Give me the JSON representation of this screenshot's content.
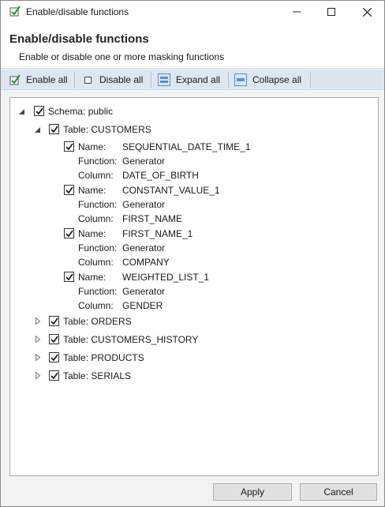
{
  "window": {
    "title": "Enable/disable functions"
  },
  "header": {
    "title": "Enable/disable functions",
    "subtitle": "Enable or disable one or more masking functions"
  },
  "toolbar": {
    "enable_all": "Enable all",
    "disable_all": "Disable all",
    "expand_all": "Expand all",
    "collapse_all": "Collapse all"
  },
  "tree": {
    "schema": "Schema: public",
    "tables": {
      "customers": "Table: CUSTOMERS",
      "orders": "Table: ORDERS",
      "customers_history": "Table: CUSTOMERS_HISTORY",
      "products": "Table: PRODUCTS",
      "serials": "Table: SERIALS"
    },
    "field_labels": {
      "name": "Name:",
      "function": "Function:",
      "column": "Column:"
    },
    "functions": [
      {
        "name": "SEQUENTIAL_DATE_TIME_1",
        "function": "Generator",
        "column": "DATE_OF_BIRTH"
      },
      {
        "name": "CONSTANT_VALUE_1",
        "function": "Generator",
        "column": "FIRST_NAME"
      },
      {
        "name": "FIRST_NAME_1",
        "function": "Generator",
        "column": "COMPANY"
      },
      {
        "name": "WEIGHTED_LIST_1",
        "function": "Generator",
        "column": "GENDER"
      }
    ]
  },
  "buttons": {
    "apply": "Apply",
    "cancel": "Cancel"
  },
  "colors": {
    "toolbar_bg": "#dbe8f3",
    "check_green": "#2e8b3a"
  }
}
